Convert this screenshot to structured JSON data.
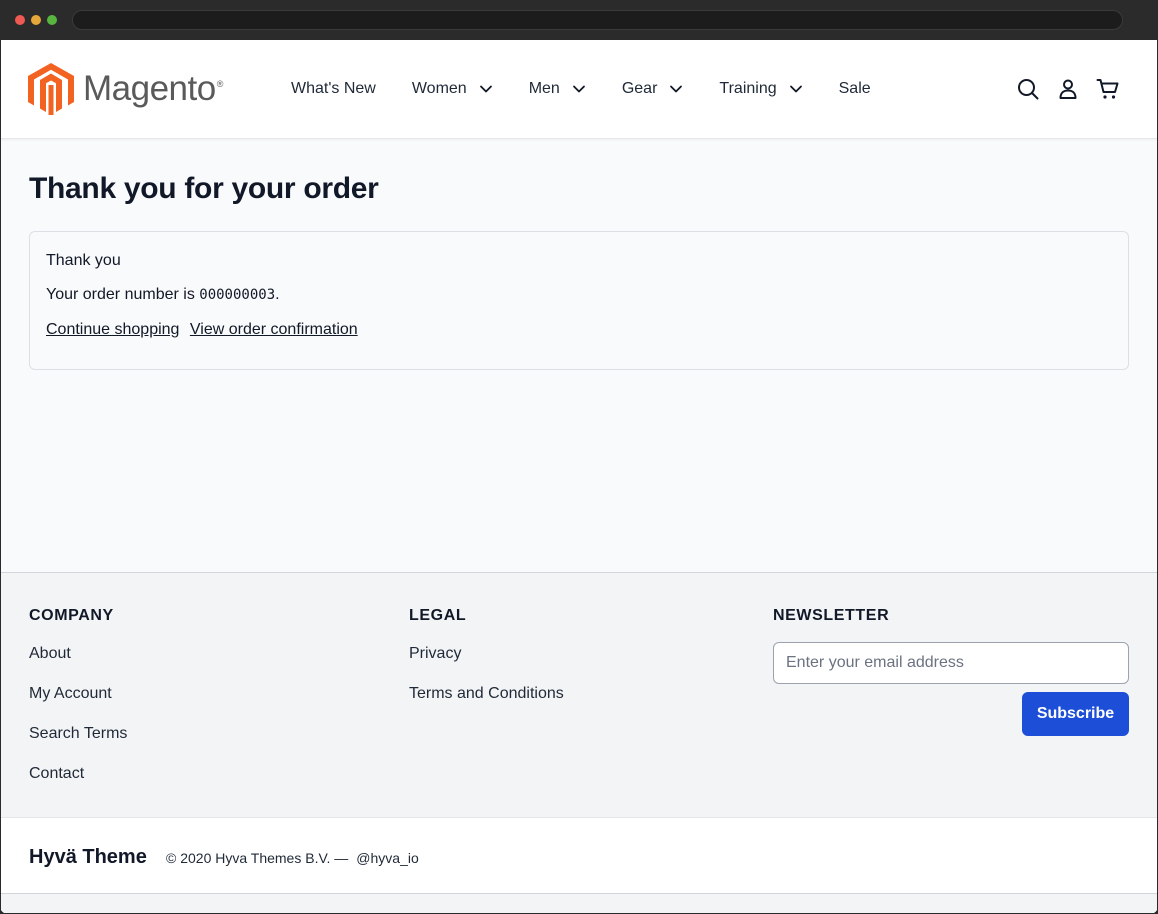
{
  "window": {
    "controls": [
      "close",
      "minimize",
      "maximize"
    ]
  },
  "header": {
    "logo_text": "Magento",
    "logo_mark": "®",
    "logo_color": "#f26322",
    "nav": [
      {
        "label": "What's New",
        "has_dropdown": false
      },
      {
        "label": "Women",
        "has_dropdown": true
      },
      {
        "label": "Men",
        "has_dropdown": true
      },
      {
        "label": "Gear",
        "has_dropdown": true
      },
      {
        "label": "Training",
        "has_dropdown": true
      },
      {
        "label": "Sale",
        "has_dropdown": false
      }
    ],
    "icons": [
      "search-icon",
      "user-icon",
      "cart-icon"
    ]
  },
  "main": {
    "title": "Thank you for your order",
    "thank_you": "Thank you",
    "order_prefix": "Your order number is ",
    "order_number": "000000003",
    "order_suffix": ".",
    "continue_link": "Continue shopping",
    "view_link": "View order confirmation"
  },
  "footer": {
    "company": {
      "title": "COMPANY",
      "links": [
        "About",
        "My Account",
        "Search Terms",
        "Contact"
      ]
    },
    "legal": {
      "title": "LEGAL",
      "links": [
        "Privacy",
        "Terms and Conditions"
      ]
    },
    "newsletter": {
      "title": "NEWSLETTER",
      "placeholder": "Enter your email address",
      "value": "",
      "button": "Subscribe",
      "button_color": "#1d4ed8"
    },
    "brand": "Hyvä Theme",
    "copyright": "© 2020 Hyva Themes B.V. —",
    "handle": "@hyva_io"
  }
}
